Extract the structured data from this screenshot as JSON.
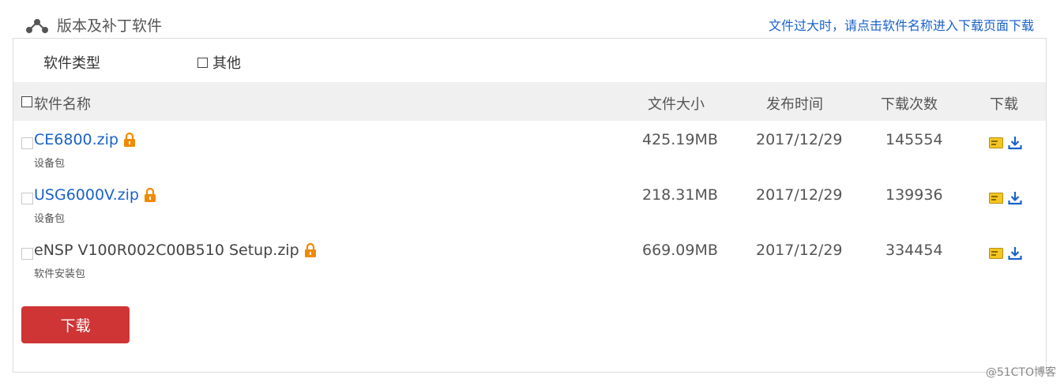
{
  "section": {
    "title": "版本及补丁软件",
    "notice": "文件过大时，请点击软件名称进入下载页面下载",
    "icon": "share-nodes-icon"
  },
  "filter": {
    "type_label": "软件类型",
    "option_label": "其他",
    "option_checked": false
  },
  "table": {
    "headers": {
      "name": "软件名称",
      "size": "文件大小",
      "date": "发布时间",
      "count": "下载次数",
      "download": "下载"
    },
    "rows": [
      {
        "name": "CE6800.zip",
        "type": "设备包",
        "size": "425.19MB",
        "date": "2017/12/29",
        "count": "145554",
        "linked": true
      },
      {
        "name": "USG6000V.zip",
        "type": "设备包",
        "size": "218.31MB",
        "date": "2017/12/29",
        "count": "139936",
        "linked": true
      },
      {
        "name": "eNSP V100R002C00B510 Setup.zip",
        "type": "软件安装包",
        "size": "669.09MB",
        "date": "2017/12/29",
        "count": "334454",
        "linked": false
      }
    ]
  },
  "download_button": "下载",
  "watermark": "@51CTO博客",
  "colors": {
    "link": "#1a62c9",
    "lock": "#f08a00",
    "button": "#cf3535",
    "header_bg": "#f0f0f0"
  }
}
